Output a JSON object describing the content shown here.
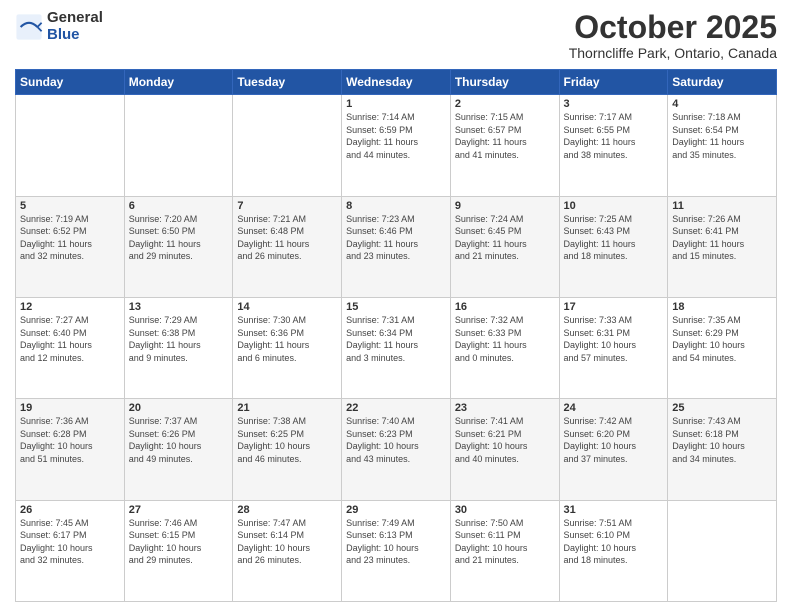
{
  "header": {
    "logo_general": "General",
    "logo_blue": "Blue",
    "month_title": "October 2025",
    "location": "Thorncliffe Park, Ontario, Canada"
  },
  "days_of_week": [
    "Sunday",
    "Monday",
    "Tuesday",
    "Wednesday",
    "Thursday",
    "Friday",
    "Saturday"
  ],
  "weeks": [
    [
      {
        "num": "",
        "info": ""
      },
      {
        "num": "",
        "info": ""
      },
      {
        "num": "",
        "info": ""
      },
      {
        "num": "1",
        "info": "Sunrise: 7:14 AM\nSunset: 6:59 PM\nDaylight: 11 hours\nand 44 minutes."
      },
      {
        "num": "2",
        "info": "Sunrise: 7:15 AM\nSunset: 6:57 PM\nDaylight: 11 hours\nand 41 minutes."
      },
      {
        "num": "3",
        "info": "Sunrise: 7:17 AM\nSunset: 6:55 PM\nDaylight: 11 hours\nand 38 minutes."
      },
      {
        "num": "4",
        "info": "Sunrise: 7:18 AM\nSunset: 6:54 PM\nDaylight: 11 hours\nand 35 minutes."
      }
    ],
    [
      {
        "num": "5",
        "info": "Sunrise: 7:19 AM\nSunset: 6:52 PM\nDaylight: 11 hours\nand 32 minutes."
      },
      {
        "num": "6",
        "info": "Sunrise: 7:20 AM\nSunset: 6:50 PM\nDaylight: 11 hours\nand 29 minutes."
      },
      {
        "num": "7",
        "info": "Sunrise: 7:21 AM\nSunset: 6:48 PM\nDaylight: 11 hours\nand 26 minutes."
      },
      {
        "num": "8",
        "info": "Sunrise: 7:23 AM\nSunset: 6:46 PM\nDaylight: 11 hours\nand 23 minutes."
      },
      {
        "num": "9",
        "info": "Sunrise: 7:24 AM\nSunset: 6:45 PM\nDaylight: 11 hours\nand 21 minutes."
      },
      {
        "num": "10",
        "info": "Sunrise: 7:25 AM\nSunset: 6:43 PM\nDaylight: 11 hours\nand 18 minutes."
      },
      {
        "num": "11",
        "info": "Sunrise: 7:26 AM\nSunset: 6:41 PM\nDaylight: 11 hours\nand 15 minutes."
      }
    ],
    [
      {
        "num": "12",
        "info": "Sunrise: 7:27 AM\nSunset: 6:40 PM\nDaylight: 11 hours\nand 12 minutes."
      },
      {
        "num": "13",
        "info": "Sunrise: 7:29 AM\nSunset: 6:38 PM\nDaylight: 11 hours\nand 9 minutes."
      },
      {
        "num": "14",
        "info": "Sunrise: 7:30 AM\nSunset: 6:36 PM\nDaylight: 11 hours\nand 6 minutes."
      },
      {
        "num": "15",
        "info": "Sunrise: 7:31 AM\nSunset: 6:34 PM\nDaylight: 11 hours\nand 3 minutes."
      },
      {
        "num": "16",
        "info": "Sunrise: 7:32 AM\nSunset: 6:33 PM\nDaylight: 11 hours\nand 0 minutes."
      },
      {
        "num": "17",
        "info": "Sunrise: 7:33 AM\nSunset: 6:31 PM\nDaylight: 10 hours\nand 57 minutes."
      },
      {
        "num": "18",
        "info": "Sunrise: 7:35 AM\nSunset: 6:29 PM\nDaylight: 10 hours\nand 54 minutes."
      }
    ],
    [
      {
        "num": "19",
        "info": "Sunrise: 7:36 AM\nSunset: 6:28 PM\nDaylight: 10 hours\nand 51 minutes."
      },
      {
        "num": "20",
        "info": "Sunrise: 7:37 AM\nSunset: 6:26 PM\nDaylight: 10 hours\nand 49 minutes."
      },
      {
        "num": "21",
        "info": "Sunrise: 7:38 AM\nSunset: 6:25 PM\nDaylight: 10 hours\nand 46 minutes."
      },
      {
        "num": "22",
        "info": "Sunrise: 7:40 AM\nSunset: 6:23 PM\nDaylight: 10 hours\nand 43 minutes."
      },
      {
        "num": "23",
        "info": "Sunrise: 7:41 AM\nSunset: 6:21 PM\nDaylight: 10 hours\nand 40 minutes."
      },
      {
        "num": "24",
        "info": "Sunrise: 7:42 AM\nSunset: 6:20 PM\nDaylight: 10 hours\nand 37 minutes."
      },
      {
        "num": "25",
        "info": "Sunrise: 7:43 AM\nSunset: 6:18 PM\nDaylight: 10 hours\nand 34 minutes."
      }
    ],
    [
      {
        "num": "26",
        "info": "Sunrise: 7:45 AM\nSunset: 6:17 PM\nDaylight: 10 hours\nand 32 minutes."
      },
      {
        "num": "27",
        "info": "Sunrise: 7:46 AM\nSunset: 6:15 PM\nDaylight: 10 hours\nand 29 minutes."
      },
      {
        "num": "28",
        "info": "Sunrise: 7:47 AM\nSunset: 6:14 PM\nDaylight: 10 hours\nand 26 minutes."
      },
      {
        "num": "29",
        "info": "Sunrise: 7:49 AM\nSunset: 6:13 PM\nDaylight: 10 hours\nand 23 minutes."
      },
      {
        "num": "30",
        "info": "Sunrise: 7:50 AM\nSunset: 6:11 PM\nDaylight: 10 hours\nand 21 minutes."
      },
      {
        "num": "31",
        "info": "Sunrise: 7:51 AM\nSunset: 6:10 PM\nDaylight: 10 hours\nand 18 minutes."
      },
      {
        "num": "",
        "info": ""
      }
    ]
  ]
}
